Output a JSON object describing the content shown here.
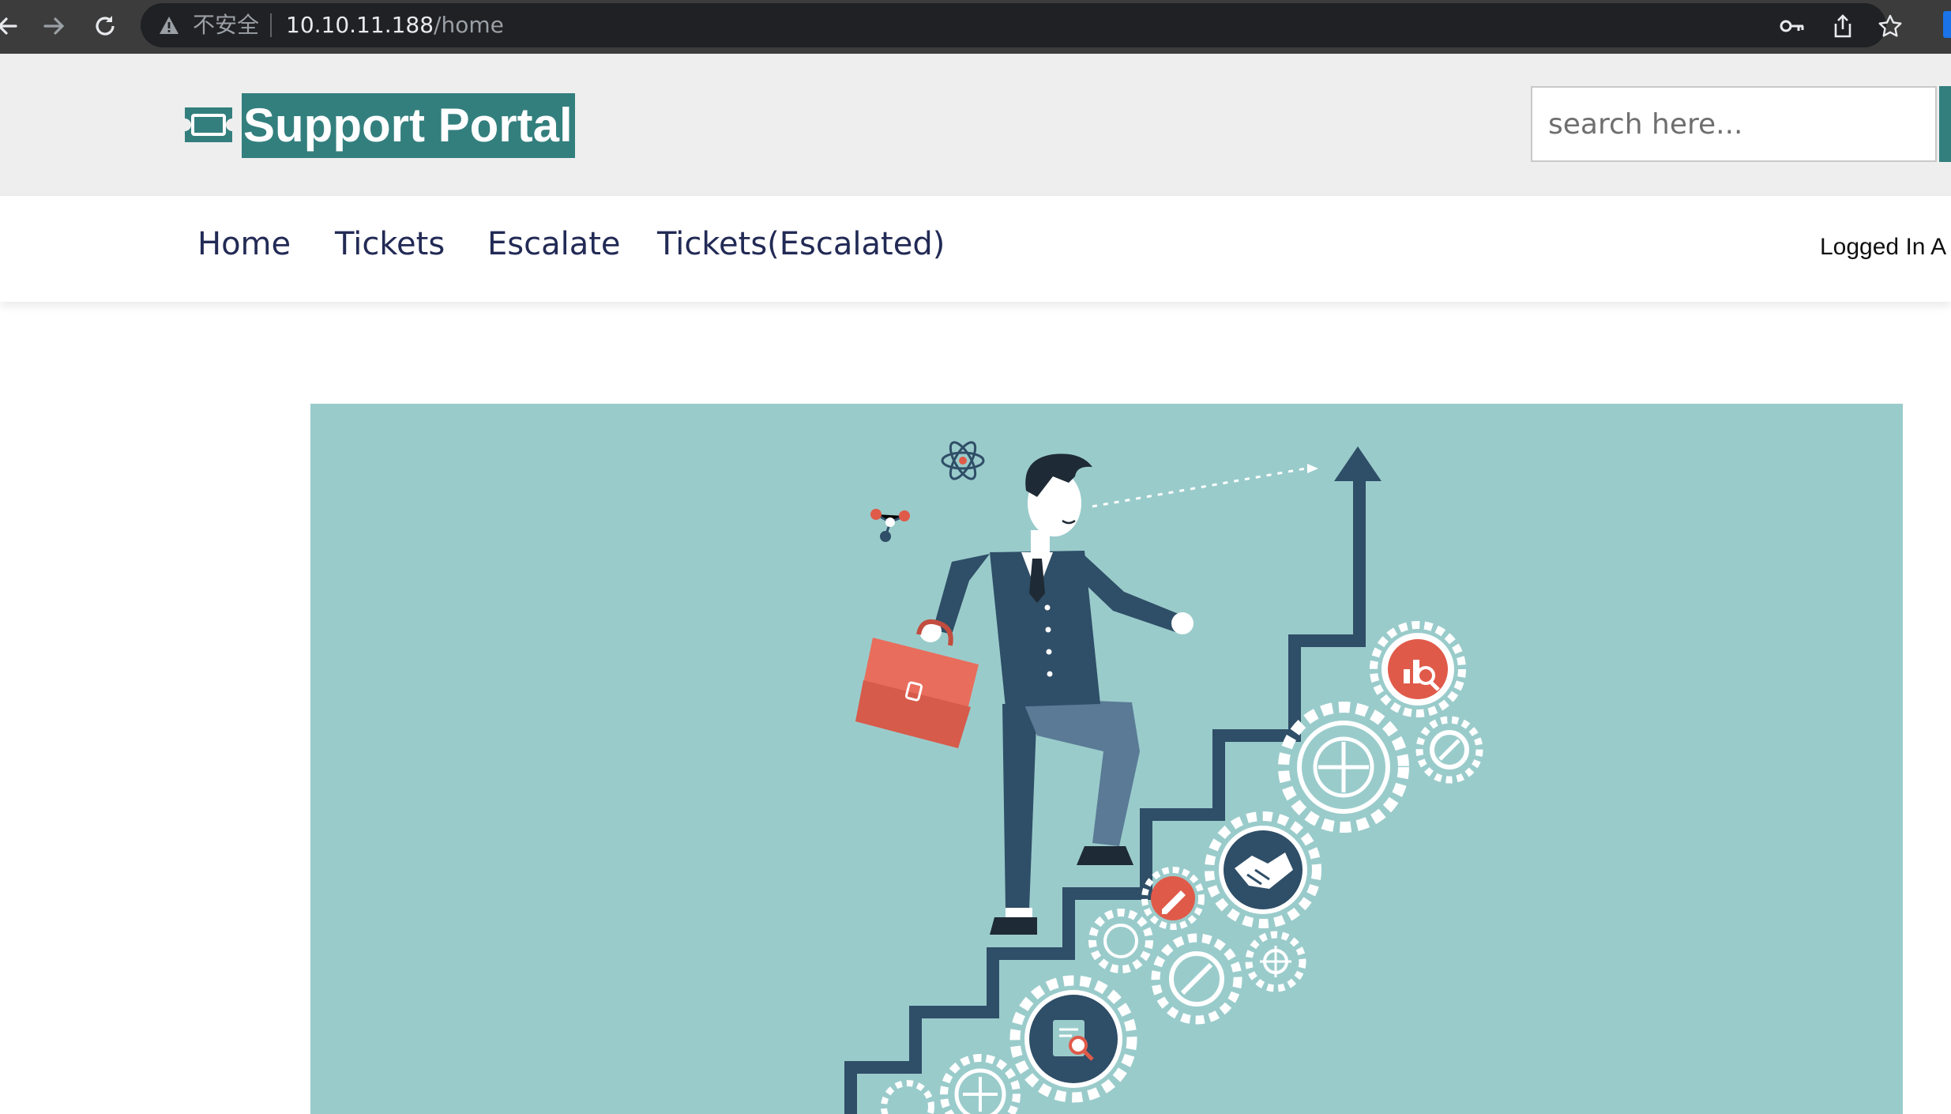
{
  "browser": {
    "security_label": "不安全",
    "url_host": "10.10.11.188",
    "url_path": "/home",
    "icons": [
      "back-icon",
      "forward-icon",
      "reload-icon",
      "warning-icon",
      "key-icon",
      "share-icon",
      "star-icon"
    ]
  },
  "header": {
    "brand": "Support Portal",
    "logo_icon": "ticket-icon",
    "search_placeholder": "search here..."
  },
  "nav": {
    "items": [
      {
        "label": "Home"
      },
      {
        "label": "Tickets"
      },
      {
        "label": "Escalate"
      },
      {
        "label": "Tickets(Escalated)"
      }
    ],
    "logged_in": "Logged In A"
  },
  "colors": {
    "brand": "#337f7e",
    "nav_text": "#222a55",
    "hero_bg": "#9acbcb",
    "accent_red": "#e05a4a",
    "dark_blue": "#2f4e67"
  }
}
